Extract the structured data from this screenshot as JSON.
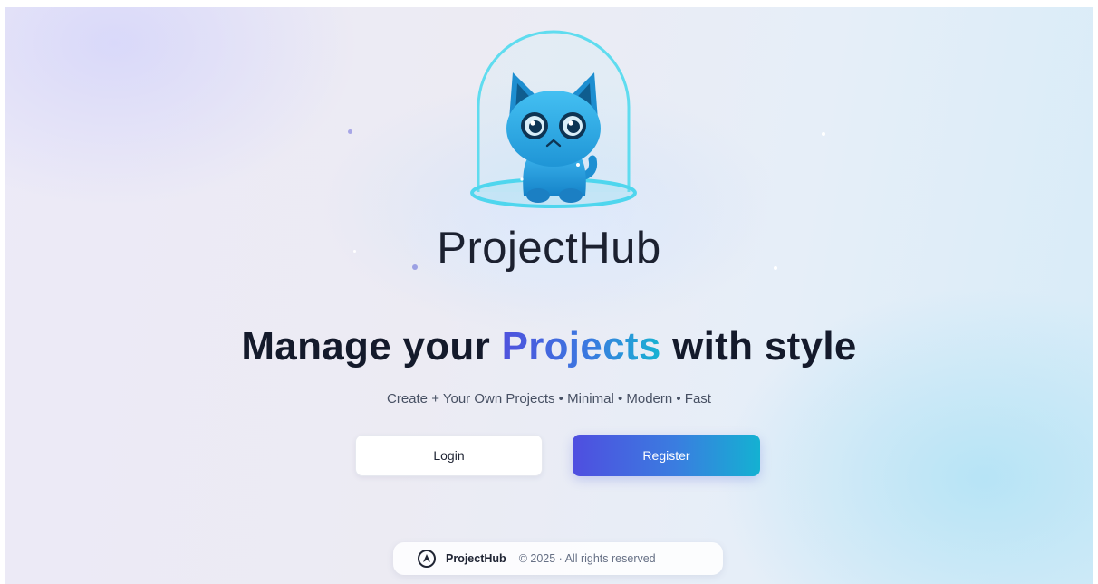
{
  "brand": {
    "logo_icon": "cat-under-glass-dome-icon",
    "name": "ProjectHub"
  },
  "hero": {
    "headline_before": "Manage your ",
    "headline_accent": "Projects",
    "headline_after": " with style",
    "subtitle": "Create + Your Own Projects • Minimal • Modern • Fast"
  },
  "actions": {
    "login_label": "Login",
    "register_label": "Register"
  },
  "footer": {
    "icon": "compass-logo-icon",
    "brand": "ProjectHub",
    "copyright": "© 2025 · All rights reserved"
  },
  "colors": {
    "headline": "#141a2b",
    "accent_start": "#4f52dd",
    "accent_end": "#17b3d2",
    "register_start": "#4f4ee0",
    "register_end": "#14b1d2"
  }
}
